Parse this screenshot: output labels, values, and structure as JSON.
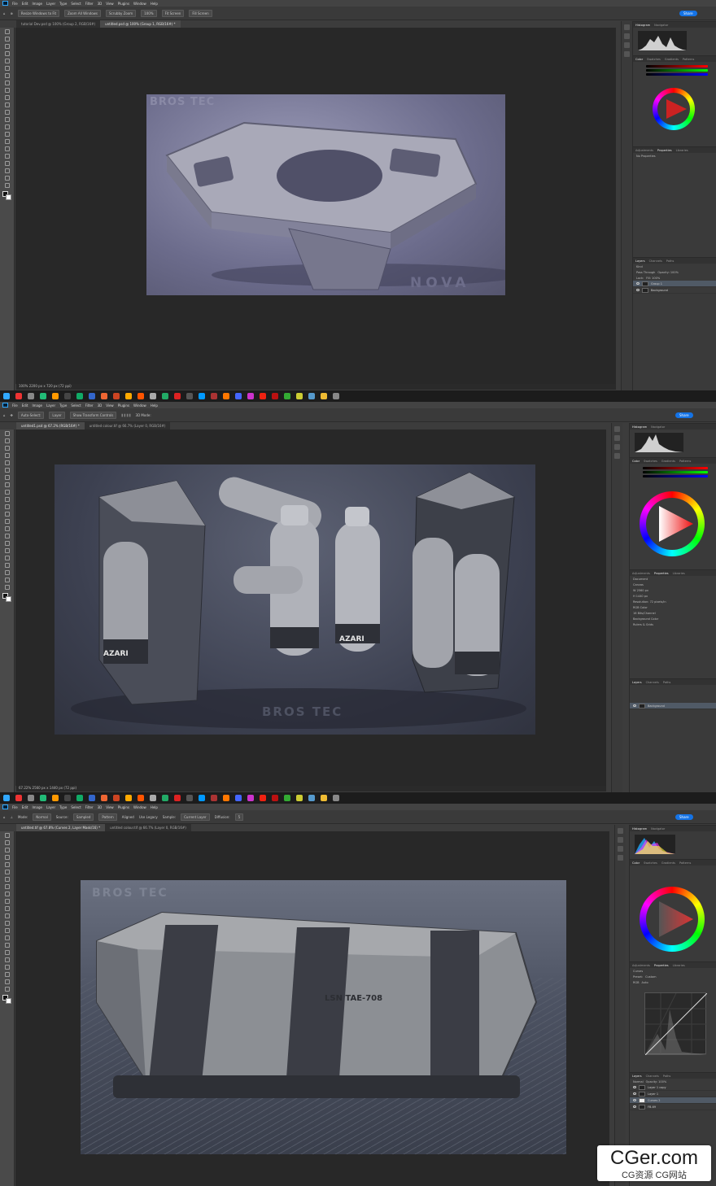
{
  "menu": [
    "File",
    "Edit",
    "Image",
    "Layer",
    "Type",
    "Select",
    "Filter",
    "3D",
    "View",
    "Plugins",
    "Window",
    "Help"
  ],
  "share_label": "Share",
  "colors": {
    "accent": "#1473e6",
    "ps_blue": "#31a8ff",
    "ui_dark": "#3c3c3c",
    "panel": "#3a3a3a"
  },
  "shot1": {
    "options": [
      "Resize Windows to Fit",
      "Zoom All Windows",
      "Scrubby Zoom",
      "100%",
      "Fit Screen",
      "Fill Screen"
    ],
    "tabs": [
      "tutorial Dev.psd @ 100% (Group 2, RGB/16#)",
      "untitled.psd @ 100% (Group 1, RGB/16#) *"
    ],
    "status": "100%   2200 px x 720 px (72 ppi)",
    "art_text": [
      "BROS TEC",
      "NOVA"
    ],
    "panel_tabs": [
      [
        "Histogram",
        "Navigator"
      ],
      [
        "Color",
        "Swatches",
        "Gradients",
        "Patterns"
      ],
      [
        "Adjustments",
        "Properties",
        "Libraries"
      ],
      [
        "Layers",
        "Channels",
        "Paths"
      ]
    ],
    "properties_text": "No Properties",
    "layer_kind": "Kind",
    "blend": "Pass Through",
    "opacity": "Opacity: 100%",
    "lock": "Lock:",
    "fill": "Fill: 100%",
    "layers": [
      "Group 1",
      "Background"
    ]
  },
  "shot2": {
    "options": [
      "Auto-Select:",
      "Layer",
      "Show Transform Controls",
      "3D Mode:"
    ],
    "tabs": [
      "untitled1.psd @ 67.2% (RGB/16#) *",
      "untitled colour.tif @ 66.7% (Layer 0, RGB/16#)"
    ],
    "status": "67.22%   2560 px x 1440 px (72 ppi)",
    "art_text": [
      "AZARI",
      "AZARI",
      "BROS TEC"
    ],
    "panel_tabs": [
      [
        "Histogram",
        "Navigator"
      ],
      [
        "Color",
        "Swatches",
        "Gradients",
        "Patterns"
      ],
      [
        "Adjustments",
        "Properties",
        "Libraries"
      ],
      [
        "Layers",
        "Channels",
        "Paths"
      ]
    ],
    "properties_text": "Document",
    "canvas_label": "Canvas",
    "canvas_w": "W 2560 px",
    "canvas_h": "H 1440 px",
    "resolution": "Resolution: 72 pixels/in",
    "mode": "RGB Color",
    "depth": "16 Bits/Channel",
    "fill_label": "Background Color",
    "rulers": "Rulers & Grids",
    "layers": [
      "Background"
    ]
  },
  "shot3": {
    "options": [
      "Mode:",
      "Normal",
      "Source:",
      "Sampled",
      "Pattern",
      "Aligned",
      "Use Legacy",
      "Sample:",
      "Current Layer",
      "Diffusion:",
      "5"
    ],
    "tabs": [
      "untitled.tif @ 67.8% (Curves 2, Layer Mask/16) *",
      "untitled colour.tif @ 66.7% (Layer 0, RGB/16#)"
    ],
    "art_text": [
      "BROS TEC",
      "LSN TAE-708"
    ],
    "panel_tabs": [
      [
        "Histogram",
        "Navigator"
      ],
      [
        "Color",
        "Swatches",
        "Gradients",
        "Patterns"
      ],
      [
        "Adjustments",
        "Properties",
        "Libraries"
      ],
      [
        "Layers",
        "Channels",
        "Paths"
      ]
    ],
    "properties_text": "Curves",
    "preset": "Preset:",
    "preset_value": "Custom",
    "channel": "RGB",
    "auto": "Auto",
    "blend": "Normal",
    "opacity": "Opacity: 100%",
    "layers": [
      "Layer 1 copy",
      "Layer 1",
      "Curves 2",
      "FB-69"
    ]
  },
  "watermark": {
    "main": "CGer.com",
    "sub": "CG资源  CG网站"
  }
}
